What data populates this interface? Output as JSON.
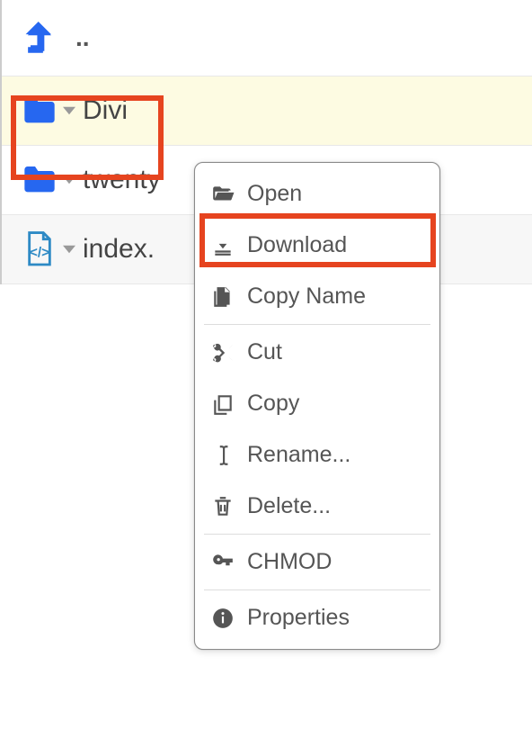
{
  "parent": {
    "label": ".."
  },
  "rows": [
    {
      "name": "Divi",
      "type": "folder"
    },
    {
      "name": "twenty",
      "type": "folder"
    },
    {
      "name": "index.",
      "type": "file"
    }
  ],
  "menu": {
    "items": [
      {
        "id": "open",
        "label": "Open"
      },
      {
        "id": "download",
        "label": "Download"
      },
      {
        "id": "copyname",
        "label": "Copy Name"
      },
      {
        "id": "cut",
        "label": "Cut"
      },
      {
        "id": "copy",
        "label": "Copy"
      },
      {
        "id": "rename",
        "label": "Rename..."
      },
      {
        "id": "delete",
        "label": "Delete..."
      },
      {
        "id": "chmod",
        "label": "CHMOD"
      },
      {
        "id": "properties",
        "label": "Properties"
      }
    ]
  }
}
